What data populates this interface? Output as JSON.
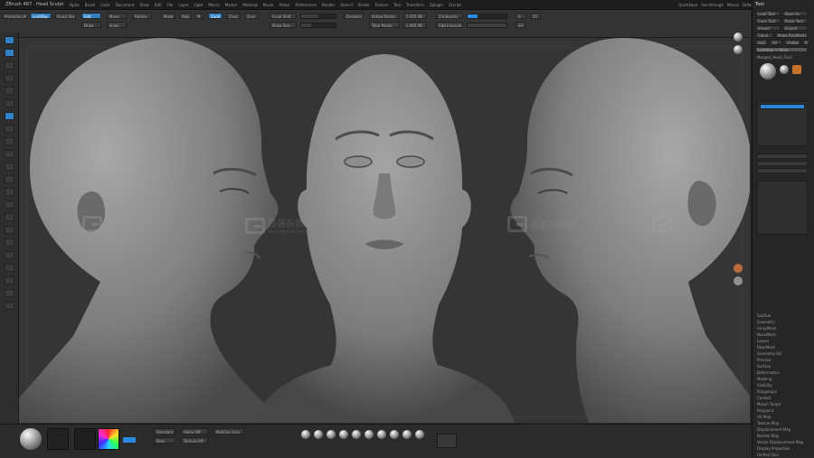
{
  "app": {
    "title": "ZBrush 4R7 · Head Sculpt",
    "menu": [
      "Alpha",
      "Brush",
      "Color",
      "Document",
      "Draw",
      "Edit",
      "File",
      "Layer",
      "Light",
      "Macro",
      "Marker",
      "Material",
      "Movie",
      "Picker",
      "Preferences",
      "Render",
      "Stencil",
      "Stroke",
      "Texture",
      "Tool",
      "Transform",
      "Zplugin",
      "Zscript"
    ],
    "right_menu": [
      "QuickSave",
      "See-through",
      "Menus",
      "DefaultZScript"
    ]
  },
  "top_shelf": {
    "buttons": [
      "Projection Master",
      "LightBox",
      "Quick Sketch",
      "Edit",
      "Draw",
      "Move",
      "Scale",
      "Rotate",
      "Mrgb",
      "Rgb",
      "M",
      "Zadd",
      "Zsub",
      "Zcut",
      "Focal Shift",
      "Draw Size",
      "Dynamic",
      "Active Points",
      "Total Points",
      "Z Intensity",
      "Rgb Intensity"
    ],
    "values": {
      "focal_shift": "0",
      "draw_size": "64",
      "z_intensity": "25",
      "active_points": "2.005 Mil",
      "total_points": "2.005 Mil"
    }
  },
  "right_panel": {
    "title": "Tool",
    "buttons": [
      "Load Tool",
      "Save As",
      "Copy Tool",
      "Paste Tool",
      "Import",
      "Export",
      "Clone",
      "Make PolyMesh3D",
      "GoZ",
      "All",
      "Visible",
      "R",
      "Lightbox > Tools"
    ],
    "tool_name": "Merged_Head_Final",
    "sections": [
      "SubTool",
      "Geometry",
      "ArrayMesh",
      "NanoMesh",
      "Layers",
      "FiberMesh",
      "Geometry HD",
      "Preview",
      "Surface",
      "Deformation",
      "Masking",
      "Visibility",
      "Polygroups",
      "Contact",
      "Morph Target",
      "Polypaint",
      "UV Map",
      "Texture Map",
      "Displacement Map",
      "Normal Map",
      "Vector Displacement Map",
      "Display Properties",
      "Unified Skin"
    ]
  },
  "watermark": {
    "text": "西基杂货铺",
    "sub": "www.cgzhou.com"
  },
  "bottom": {
    "labels": [
      "Standard",
      "Dots",
      "Alpha Off",
      "Texture Off",
      "MatCap Gray"
    ]
  },
  "colors": {
    "accent": "#2c8be0",
    "bg": "#353535",
    "skin": "#8a8a8a"
  }
}
